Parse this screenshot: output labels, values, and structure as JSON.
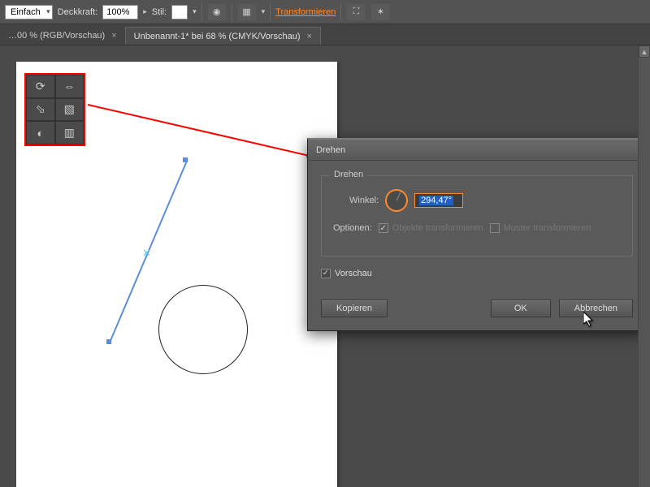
{
  "toolbar": {
    "brush_mode": "Einfach",
    "opacity_label": "Deckkraft:",
    "opacity_value": "100%",
    "style_label": "Stil:",
    "transform_link": "Transformieren"
  },
  "tabs": [
    {
      "label": "…00 % (RGB/Vorschau)",
      "active": false
    },
    {
      "label": "Unbenannt-1* bei 68 % (CMYK/Vorschau)",
      "active": true
    }
  ],
  "tool_palette": {
    "icons": [
      "rotate-icon",
      "reflect-icon",
      "reshape-icon",
      "free-transform-icon",
      "shear-icon",
      "scale-icon"
    ]
  },
  "dialog": {
    "title": "Drehen",
    "group_title": "Drehen",
    "angle_label": "Winkel:",
    "angle_value": "294,47°",
    "options_label": "Optionen:",
    "opt_objects": "Objekte transformieren",
    "opt_patterns": "Muster transformieren",
    "preview_label": "Vorschau",
    "buttons": {
      "copy": "Kopieren",
      "ok": "OK",
      "cancel": "Abbrechen"
    }
  }
}
